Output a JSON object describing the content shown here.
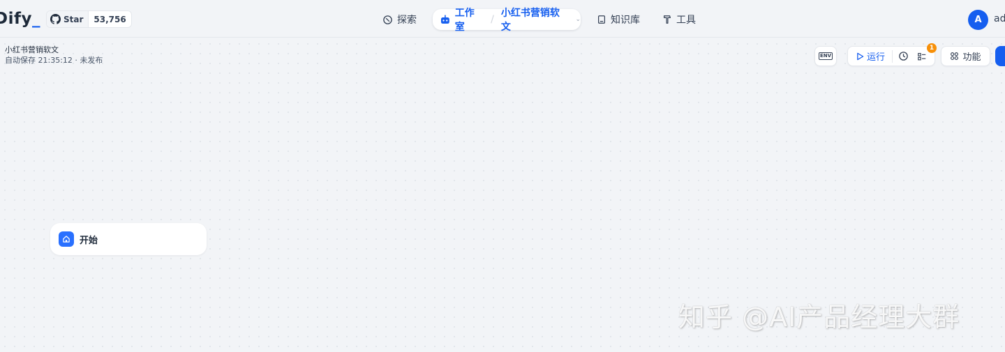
{
  "brand": {
    "logo_text": "Dify",
    "logo_cursor": "_"
  },
  "github": {
    "star_label": "Star",
    "star_count": "53,756"
  },
  "nav": {
    "explore": "探索",
    "studio": "工作室",
    "current_app": "小红书营销软文",
    "knowledge": "知识库",
    "tools": "工具"
  },
  "user": {
    "avatar_initial": "A",
    "name_partial": "ad"
  },
  "app": {
    "name": "小红书营销软文",
    "status": "自动保存 21:35:12 · 未发布"
  },
  "toolbar": {
    "env_label": "ENV",
    "run_label": "运行",
    "checklist_badge": "1",
    "features_label": "功能"
  },
  "canvas": {
    "start_node_label": "开始"
  },
  "watermark": "知乎 @AI产品经理大群",
  "colors": {
    "accent": "#155eef",
    "badge": "#f79009",
    "canvas_bg": "#f2f4f7"
  }
}
